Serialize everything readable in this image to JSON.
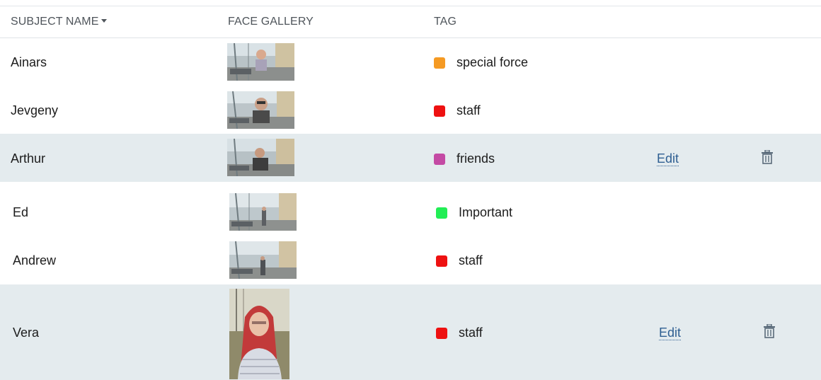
{
  "columns": {
    "subject_name": "SUBJECT NAME",
    "face_gallery": "FACE GALLERY",
    "tag": "TAG"
  },
  "rows": [
    {
      "name": "Ainars",
      "tag": "special force",
      "tag_color": "#f59a23",
      "highlighted": false
    },
    {
      "name": "Jevgeny",
      "tag": "staff",
      "tag_color": "#ee1111",
      "highlighted": false
    },
    {
      "name": "Arthur",
      "tag": "friends",
      "tag_color": "#c44aa4",
      "highlighted": true,
      "edit_label": "Edit",
      "delete_icon": "trash-icon"
    },
    {
      "name": "Ed",
      "tag": "Important",
      "tag_color": "#22ee55",
      "highlighted": false
    },
    {
      "name": "Andrew",
      "tag": "staff",
      "tag_color": "#ee1111",
      "highlighted": false
    },
    {
      "name": "Vera",
      "tag": "staff",
      "tag_color": "#ee1111",
      "highlighted": true,
      "edit_label": "Edit",
      "delete_icon": "trash-icon"
    }
  ],
  "colors": {
    "highlight_row": "#e4ebee",
    "link": "#2f5f92"
  }
}
